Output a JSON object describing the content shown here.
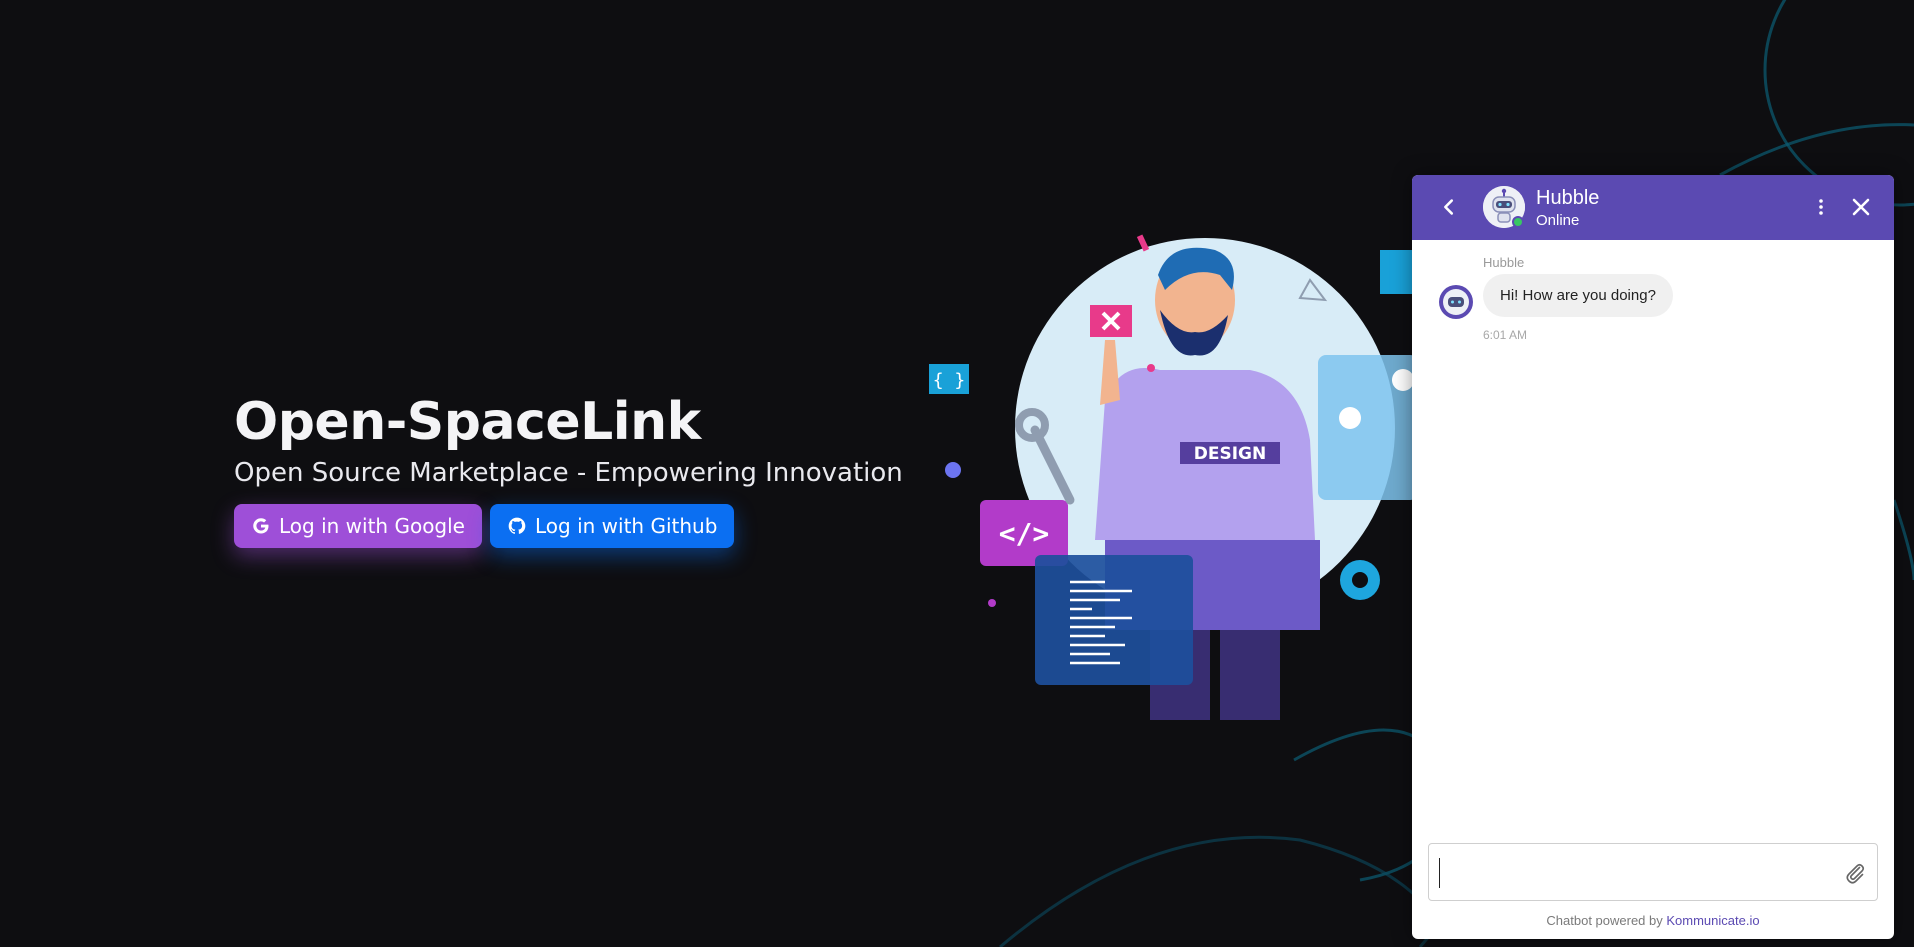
{
  "hero": {
    "title": "Open-SpaceLink",
    "subtitle": "Open Source Marketplace - Empowering Innovation",
    "google_label": "Log in with Google",
    "github_label": "Log in with Github"
  },
  "illustration": {
    "shirt_text": "DESIGN",
    "code_badge": "</>"
  },
  "chat": {
    "header": {
      "name": "Hubble",
      "status": "Online"
    },
    "messages": [
      {
        "sender": "Hubble",
        "text": "Hi! How are you doing?",
        "time": "6:01 AM"
      }
    ],
    "input": {
      "placeholder": ""
    },
    "footer": {
      "prefix": "Chatbot powered by ",
      "link": "Kommunicate.io"
    }
  },
  "colors": {
    "background": "#0e0e11",
    "google_button": "#9e4fd8",
    "github_button": "#0b6ff2",
    "chat_header": "#5b4ab2",
    "online_dot": "#38c763"
  },
  "icons": [
    "google-icon",
    "github-icon",
    "back-arrow-icon",
    "bot-avatar-icon",
    "more-vertical-icon",
    "close-icon",
    "paperclip-icon"
  ]
}
